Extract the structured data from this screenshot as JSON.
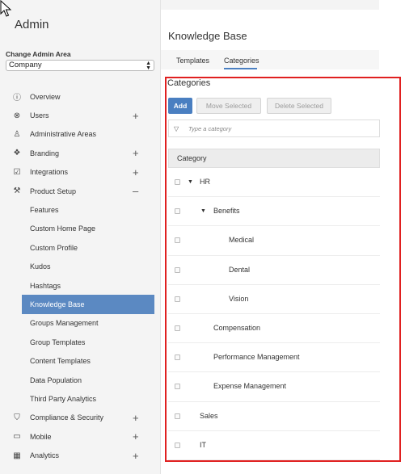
{
  "sidebar": {
    "title": "Admin",
    "change_label": "Change Admin Area",
    "selected_area": "Company",
    "items": [
      {
        "label": "Overview",
        "icon": "info-icon",
        "toggle": ""
      },
      {
        "label": "Users",
        "icon": "user-icon",
        "toggle": "+"
      },
      {
        "label": "Administrative Areas",
        "icon": "org-chart-icon",
        "toggle": ""
      },
      {
        "label": "Branding",
        "icon": "branding-icon",
        "toggle": "+"
      },
      {
        "label": "Integrations",
        "icon": "integrations-icon",
        "toggle": "+"
      },
      {
        "label": "Product Setup",
        "icon": "wrench-icon",
        "toggle": "–"
      },
      {
        "label": "Features",
        "sub": true
      },
      {
        "label": "Custom Home Page",
        "sub": true
      },
      {
        "label": "Custom Profile",
        "sub": true
      },
      {
        "label": "Kudos",
        "sub": true
      },
      {
        "label": "Hashtags",
        "sub": true
      },
      {
        "label": "Knowledge Base",
        "sub": true,
        "active": true
      },
      {
        "label": "Groups Management",
        "sub": true
      },
      {
        "label": "Group Templates",
        "sub": true
      },
      {
        "label": "Content Templates",
        "sub": true
      },
      {
        "label": "Data Population",
        "sub": true
      },
      {
        "label": "Third Party Analytics",
        "sub": true
      },
      {
        "label": "Compliance & Security",
        "icon": "shield-icon",
        "toggle": "+"
      },
      {
        "label": "Mobile",
        "icon": "mobile-icon",
        "toggle": "+"
      },
      {
        "label": "Analytics",
        "icon": "analytics-icon",
        "toggle": "+"
      }
    ]
  },
  "main": {
    "title": "Knowledge Base",
    "tabs": [
      "Templates",
      "Categories"
    ],
    "active_tab": "Categories",
    "section_title": "Categories",
    "buttons": {
      "add": "Add",
      "move": "Move Selected",
      "delete": "Delete Selected"
    },
    "filter_placeholder": "Type a category",
    "table_header": "Category",
    "rows": [
      {
        "label": "HR",
        "level": 0,
        "expanded": true
      },
      {
        "label": "Benefits",
        "level": 1,
        "expanded": true
      },
      {
        "label": "Medical",
        "level": 2
      },
      {
        "label": "Dental",
        "level": 2
      },
      {
        "label": "Vision",
        "level": 2
      },
      {
        "label": "Compensation",
        "level": 1
      },
      {
        "label": "Performance Management",
        "level": 1
      },
      {
        "label": "Expense Management",
        "level": 1
      },
      {
        "label": "Sales",
        "level": 0
      },
      {
        "label": "IT",
        "level": 0
      }
    ]
  },
  "colors": {
    "accent": "#4a7fc1",
    "active_nav": "#5b89c2",
    "highlight_box": "#e02020"
  }
}
